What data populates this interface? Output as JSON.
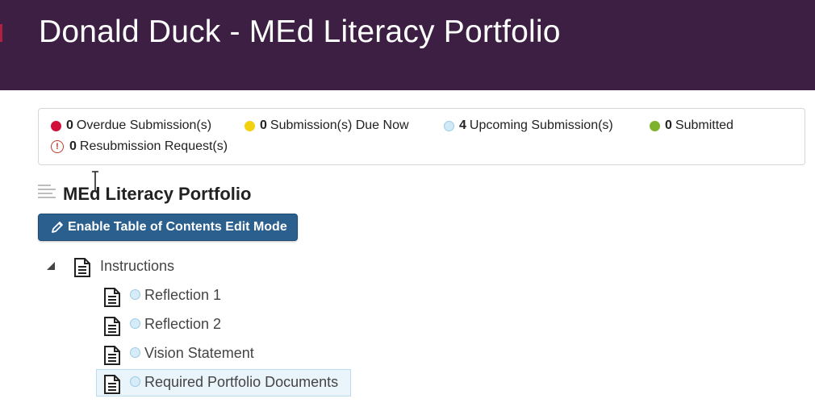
{
  "header": {
    "title": "Donald Duck - MEd Literacy Portfolio",
    "background": "#3c1f42"
  },
  "status": {
    "overdue": {
      "count": "0",
      "label": "Overdue Submission(s)",
      "color": "#d0103a"
    },
    "due_now": {
      "count": "0",
      "label": "Submission(s) Due Now",
      "color": "#f2d10f"
    },
    "upcoming": {
      "count": "4",
      "label": "Upcoming Submission(s)",
      "color": "#cfe9f7"
    },
    "submitted": {
      "count": "0",
      "label": "Submitted",
      "color": "#7db32a"
    },
    "resubmission": {
      "count": "0",
      "label": "Resubmission Request(s)",
      "icon": "exclamation-circle-icon",
      "symbol": "!"
    }
  },
  "section": {
    "title": "MEd Literacy Portfolio",
    "icon": "table-of-contents-icon"
  },
  "edit_button": {
    "label": "Enable Table of Contents Edit Mode",
    "icon": "pencil-icon",
    "color": "#2a5f8e"
  },
  "tree": {
    "root": {
      "label": "Instructions",
      "icon": "document-icon",
      "expanded": true
    },
    "children": [
      {
        "label": "Reflection 1",
        "status": "upcoming"
      },
      {
        "label": "Reflection 2",
        "status": "upcoming"
      },
      {
        "label": "Vision Statement",
        "status": "upcoming"
      },
      {
        "label": "Required Portfolio Documents",
        "status": "upcoming",
        "selected": true
      }
    ]
  }
}
